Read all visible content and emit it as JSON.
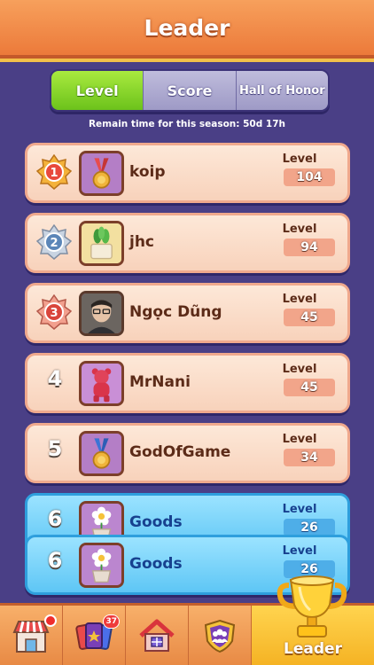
{
  "header": {
    "title": "Leader"
  },
  "tabs": [
    {
      "label": "Level",
      "active": true
    },
    {
      "label": "Score",
      "active": false
    },
    {
      "label": "Hall of Honor",
      "active": false
    }
  ],
  "season": {
    "text": "Remain time for this season:  50d 17h"
  },
  "level_label": "Level",
  "rows": [
    {
      "rank": "1",
      "name": "koip",
      "level": "104",
      "avatar_icon": "medal-icon"
    },
    {
      "rank": "2",
      "name": "jhc",
      "level": "94",
      "avatar_icon": "plant-pot-icon"
    },
    {
      "rank": "3",
      "name": "Ngọc Dũng",
      "level": "45",
      "avatar_icon": "person-photo"
    },
    {
      "rank": "4",
      "name": "MrNani",
      "level": "45",
      "avatar_icon": "bear-figure-icon"
    },
    {
      "rank": "5",
      "name": "GodOfGame",
      "level": "34",
      "avatar_icon": "medal-icon"
    },
    {
      "rank": "6",
      "name": "Goods",
      "level": "26",
      "avatar_icon": "flower-pot-icon"
    }
  ],
  "self_row": {
    "rank": "6",
    "name": "Goods",
    "level": "26",
    "avatar_icon": "flower-pot-icon"
  },
  "nav": {
    "shop_icon": "shop-icon",
    "cards_badge": "37",
    "home_icon": "house-icon",
    "team_icon": "team-shield-icon",
    "leader_label": "Leader"
  },
  "colors": {
    "background": "#4a3f86",
    "header": "#ec7a3a",
    "tab_active": "#6cc21b",
    "row": "#fde8d8",
    "row_self": "#5ec6f5"
  }
}
